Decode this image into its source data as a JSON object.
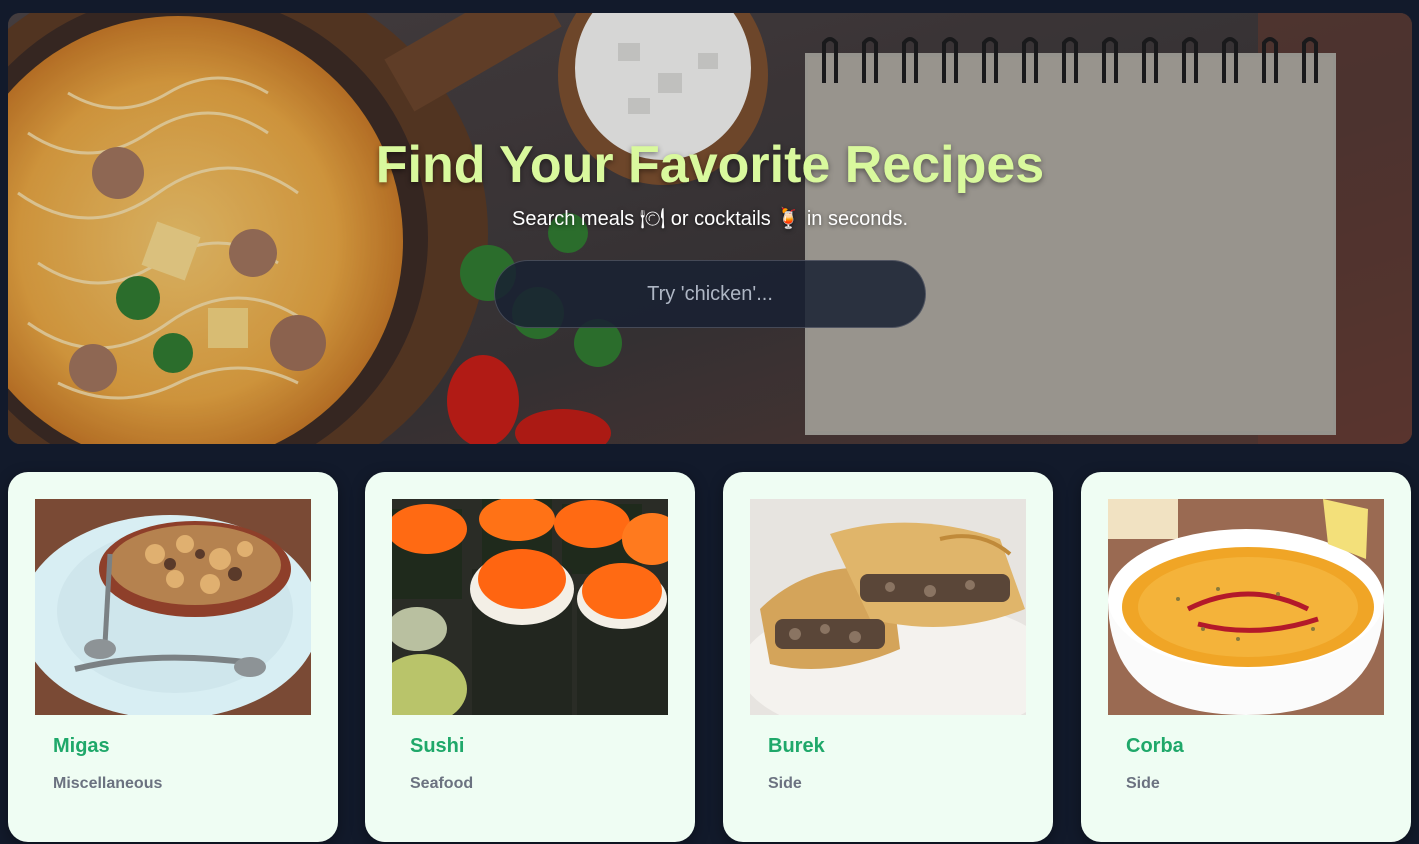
{
  "hero": {
    "title": "Find Your Favorite Recipes",
    "subtitle_prefix": "Search meals",
    "meal_icon": "🍽",
    "subtitle_middle": "or cocktails",
    "cocktail_icon": "🍹",
    "subtitle_suffix": "in seconds."
  },
  "search": {
    "placeholder": "Try 'chicken'...",
    "value": ""
  },
  "colors": {
    "background": "#121a2b",
    "title": "#d9f99d",
    "card_background": "#effdf3",
    "card_name": "#1fa86a",
    "card_category": "#6b7280"
  },
  "recipes": [
    {
      "name": "Migas",
      "category": "Miscellaneous",
      "image": "migas-photo"
    },
    {
      "name": "Sushi",
      "category": "Seafood",
      "image": "sushi-photo"
    },
    {
      "name": "Burek",
      "category": "Side",
      "image": "burek-photo"
    },
    {
      "name": "Corba",
      "category": "Side",
      "image": "corba-photo"
    }
  ]
}
